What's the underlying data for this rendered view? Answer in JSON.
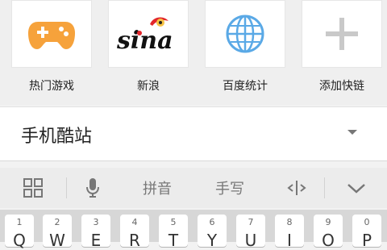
{
  "shortcuts": [
    {
      "label": "热门游戏",
      "icon": "gamepad-icon"
    },
    {
      "label": "新浪",
      "icon": "sina-logo"
    },
    {
      "label": "百度统计",
      "icon": "globe-icon"
    },
    {
      "label": "添加快链",
      "icon": "plus-icon"
    }
  ],
  "sina_logo_text": "sina",
  "urlbar": {
    "text": "手机酷站"
  },
  "ime": {
    "items": [
      {
        "label": "",
        "icon": "grid-icon"
      },
      {
        "label": "",
        "icon": "microphone-icon"
      },
      {
        "label": "拼音",
        "icon": ""
      },
      {
        "label": "手写",
        "icon": ""
      },
      {
        "label": "",
        "icon": "cursor-move-icon"
      },
      {
        "label": "",
        "icon": "chevron-down-icon"
      }
    ]
  },
  "keyboard": {
    "keys": [
      {
        "num": "1",
        "let": "Q"
      },
      {
        "num": "2",
        "let": "W"
      },
      {
        "num": "3",
        "let": "E"
      },
      {
        "num": "4",
        "let": "R"
      },
      {
        "num": "5",
        "let": "T"
      },
      {
        "num": "6",
        "let": "Y"
      },
      {
        "num": "7",
        "let": "U"
      },
      {
        "num": "8",
        "let": "I"
      },
      {
        "num": "9",
        "let": "O"
      },
      {
        "num": "0",
        "let": "P"
      }
    ]
  },
  "colors": {
    "gamepad": "#f6a23b",
    "sina_red": "#e2262b",
    "globe": "#5aa9e6",
    "plus": "#c9c9c9"
  }
}
